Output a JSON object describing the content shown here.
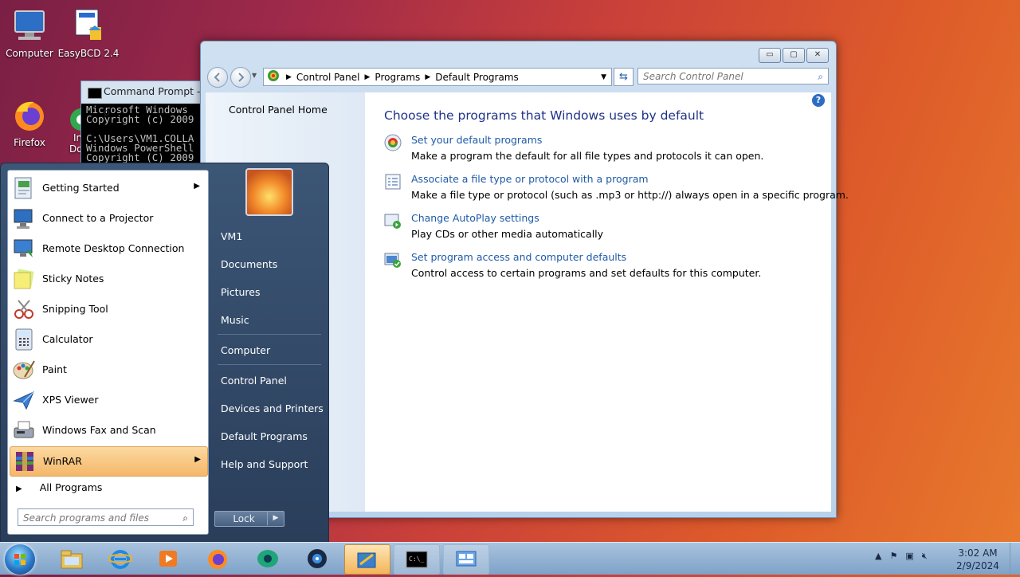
{
  "desktop": {
    "icons": [
      {
        "label": "Computer"
      },
      {
        "label": "EasyBCD 2.4"
      },
      {
        "label": "Firefox"
      },
      {
        "label": "In"
      },
      {
        "label": "Do"
      }
    ]
  },
  "cmd_window": {
    "title": "Command Prompt - p",
    "lines": "Microsoft Windows\nCopyright (c) 2009\n\nC:\\Users\\VM1.COLLA\nWindows PowerShell\nCopyright (C) 2009"
  },
  "control_panel": {
    "window_buttons": {
      "minimize": "▭",
      "maximize": "▢",
      "close": "✕"
    },
    "breadcrumb": [
      "Control Panel",
      "Programs",
      "Default Programs"
    ],
    "search_placeholder": "Search Control Panel",
    "left_nav": {
      "home": "Control Panel Home"
    },
    "heading": "Choose the programs that Windows uses by default",
    "tasks": [
      {
        "link": "Set your default programs",
        "desc": "Make a program the default for all file types and protocols it can open.",
        "icon": "default-programs-icon"
      },
      {
        "link": "Associate a file type or protocol with a program",
        "desc": "Make a file type or protocol (such as .mp3 or http://) always open in a specific program.",
        "icon": "file-association-icon"
      },
      {
        "link": "Change AutoPlay settings",
        "desc": "Play CDs or other media automatically",
        "icon": "autoplay-icon"
      },
      {
        "link": "Set program access and computer defaults",
        "desc": "Control access to certain programs and set defaults for this computer.",
        "icon": "program-access-icon"
      }
    ]
  },
  "start_menu": {
    "programs": [
      {
        "label": "Getting Started",
        "submenu": true
      },
      {
        "label": "Connect to a Projector",
        "submenu": false
      },
      {
        "label": "Remote Desktop Connection",
        "submenu": false
      },
      {
        "label": "Sticky Notes",
        "submenu": false
      },
      {
        "label": "Snipping Tool",
        "submenu": false
      },
      {
        "label": "Calculator",
        "submenu": false
      },
      {
        "label": "Paint",
        "submenu": false
      },
      {
        "label": "XPS Viewer",
        "submenu": false
      },
      {
        "label": "Windows Fax and Scan",
        "submenu": false
      },
      {
        "label": "WinRAR",
        "submenu": true,
        "highlighted": true
      }
    ],
    "all_programs": "All Programs",
    "search_placeholder": "Search programs and files",
    "right_items": [
      "VM1",
      "Documents",
      "Pictures",
      "Music",
      "Computer",
      "Control Panel",
      "Devices and Printers",
      "Default Programs",
      "Help and Support"
    ],
    "lock_label": "Lock"
  },
  "taskbar": {
    "clock_time": "3:02 AM",
    "clock_date": "2/9/2024",
    "pinned": [
      "file-explorer-icon",
      "internet-explorer-icon",
      "media-player-icon",
      "firefox-icon",
      "chat-app-icon",
      "easybcd-icon",
      "control-panel-icon",
      "command-prompt-icon",
      "remote-desktop-icon"
    ]
  }
}
